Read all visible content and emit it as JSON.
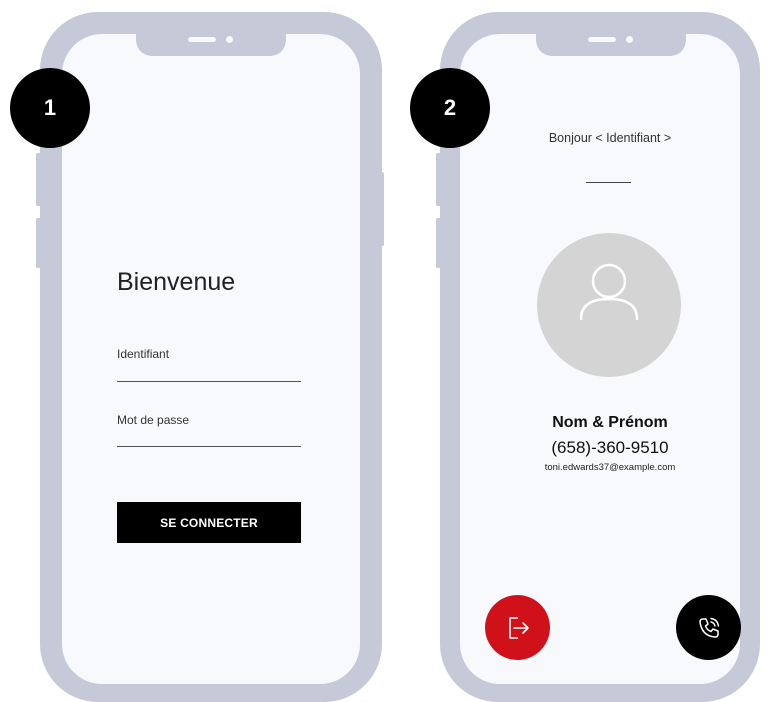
{
  "steps": {
    "first": "1",
    "second": "2"
  },
  "login_screen": {
    "title": "Bienvenue",
    "username_label": "Identifiant",
    "password_label": "Mot de passe",
    "submit_label": "SE CONNECTER"
  },
  "profile_screen": {
    "greeting": "Bonjour < Identifiant >",
    "avatar_icon": "user-icon",
    "name": "Nom & Prénom",
    "phone": "(658)-360-9510",
    "email": "toni.edwards37@example.com",
    "logout_icon": "logout-icon",
    "call_icon": "phone-call-icon"
  },
  "colors": {
    "device_frame": "#c5c9d8",
    "screen_background": "#f8f9fc",
    "primary_button": "#000000",
    "logout_button": "#d0111a",
    "avatar_background": "#d4d4d4"
  }
}
